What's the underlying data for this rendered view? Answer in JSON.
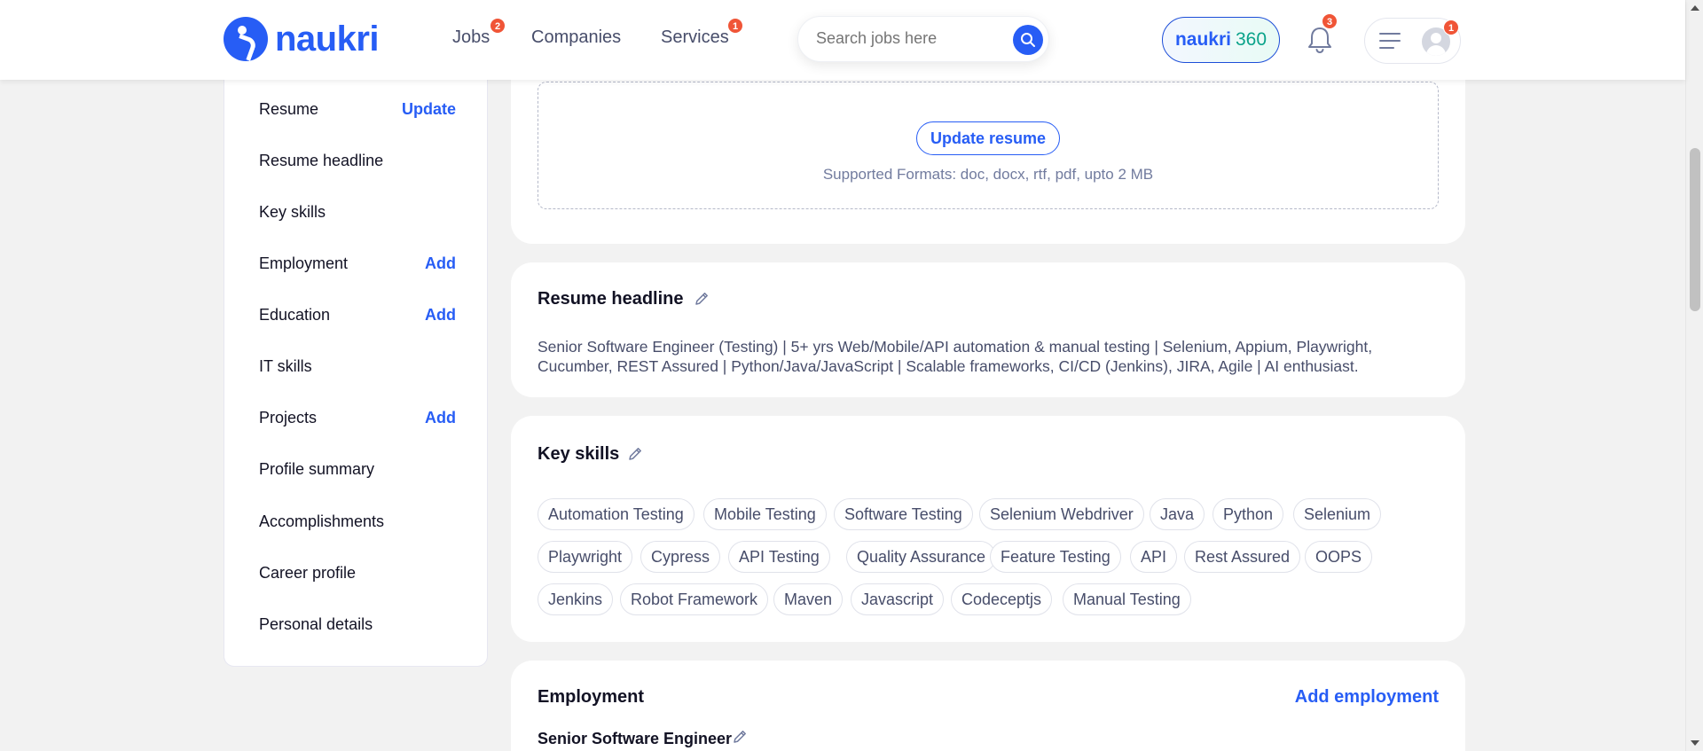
{
  "header": {
    "logo_text": "naukri",
    "nav": [
      {
        "label": "Jobs",
        "badge": "2"
      },
      {
        "label": "Companies"
      },
      {
        "label": "Services",
        "badge": "1"
      }
    ],
    "search_placeholder": "Search jobs here",
    "naukri360": {
      "part1": "naukri",
      "part2": "360"
    },
    "notifications_badge": "3",
    "menu_badge": "1"
  },
  "sidebar": {
    "items": [
      {
        "label": "Resume",
        "action": "Update"
      },
      {
        "label": "Resume headline",
        "action": ""
      },
      {
        "label": "Key skills",
        "action": ""
      },
      {
        "label": "Employment",
        "action": "Add"
      },
      {
        "label": "Education",
        "action": "Add"
      },
      {
        "label": "IT skills",
        "action": ""
      },
      {
        "label": "Projects",
        "action": "Add"
      },
      {
        "label": "Profile summary",
        "action": ""
      },
      {
        "label": "Accomplishments",
        "action": ""
      },
      {
        "label": "Career profile",
        "action": ""
      },
      {
        "label": "Personal details",
        "action": ""
      }
    ]
  },
  "resume": {
    "button_label": "Update resume",
    "formats": "Supported Formats: doc, docx, rtf, pdf, upto 2 MB"
  },
  "headline": {
    "title": "Resume headline",
    "text": "Senior Software Engineer (Testing) | 5+ yrs Web/Mobile/API automation & manual testing | Selenium, Appium, Playwright, Cucumber, REST Assured | Python/Java/JavaScript | Scalable frameworks, CI/CD (Jenkins), JIRA, Agile | AI enthusiast."
  },
  "key_skills": {
    "title": "Key skills",
    "skills": [
      "Automation Testing",
      "Mobile Testing",
      "Software Testing",
      "Selenium Webdriver",
      "Java",
      "Python",
      "Selenium",
      "Playwright",
      "Cypress",
      "API Testing",
      "Quality Assurance",
      "Feature Testing",
      "API",
      "Rest Assured",
      "OOPS",
      "Jenkins",
      "Robot Framework",
      "Maven",
      "Javascript",
      "Codeceptjs",
      "Manual Testing"
    ]
  },
  "employment": {
    "title": "Employment",
    "add_label": "Add employment",
    "role": "Senior Software Engineer"
  },
  "colors": {
    "accent": "#275df5",
    "badge": "#f05537",
    "teal": "#0aa38a"
  }
}
